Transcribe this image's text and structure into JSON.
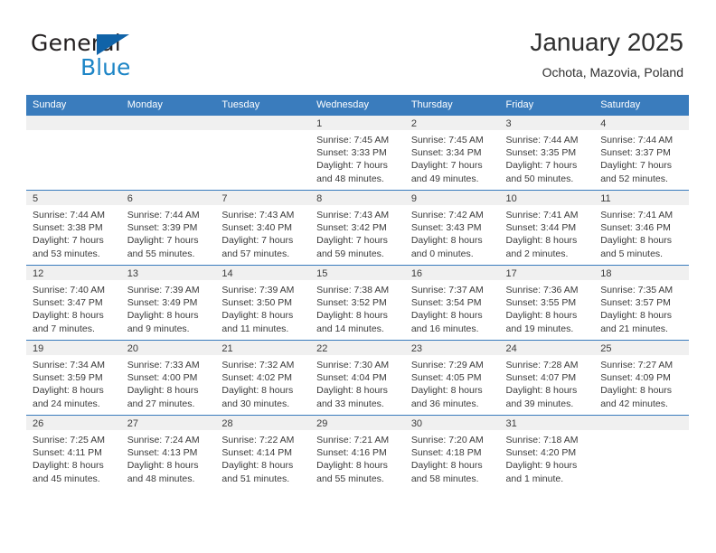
{
  "brand": {
    "name_part1": "General",
    "name_part2": "Blue",
    "triangle_color": "#1063a8",
    "blue_color": "#1d85c6"
  },
  "header": {
    "title": "January 2025",
    "location": "Ochota, Mazovia, Poland"
  },
  "theme": {
    "header_blue": "#3a7cbd",
    "band_gray": "#f0f0f0",
    "text": "#3a3a3a"
  },
  "weekdays": [
    "Sunday",
    "Monday",
    "Tuesday",
    "Wednesday",
    "Thursday",
    "Friday",
    "Saturday"
  ],
  "labels": {
    "sunrise_prefix": "Sunrise: ",
    "sunset_prefix": "Sunset: ",
    "daylight_prefix": "Daylight: "
  },
  "weeks": [
    [
      {
        "day": "",
        "empty": true
      },
      {
        "day": "",
        "empty": true
      },
      {
        "day": "",
        "empty": true
      },
      {
        "day": "1",
        "sunrise": "Sunrise: 7:45 AM",
        "sunset": "Sunset: 3:33 PM",
        "daylight1": "Daylight: 7 hours",
        "daylight2": "and 48 minutes."
      },
      {
        "day": "2",
        "sunrise": "Sunrise: 7:45 AM",
        "sunset": "Sunset: 3:34 PM",
        "daylight1": "Daylight: 7 hours",
        "daylight2": "and 49 minutes."
      },
      {
        "day": "3",
        "sunrise": "Sunrise: 7:44 AM",
        "sunset": "Sunset: 3:35 PM",
        "daylight1": "Daylight: 7 hours",
        "daylight2": "and 50 minutes."
      },
      {
        "day": "4",
        "sunrise": "Sunrise: 7:44 AM",
        "sunset": "Sunset: 3:37 PM",
        "daylight1": "Daylight: 7 hours",
        "daylight2": "and 52 minutes."
      }
    ],
    [
      {
        "day": "5",
        "sunrise": "Sunrise: 7:44 AM",
        "sunset": "Sunset: 3:38 PM",
        "daylight1": "Daylight: 7 hours",
        "daylight2": "and 53 minutes."
      },
      {
        "day": "6",
        "sunrise": "Sunrise: 7:44 AM",
        "sunset": "Sunset: 3:39 PM",
        "daylight1": "Daylight: 7 hours",
        "daylight2": "and 55 minutes."
      },
      {
        "day": "7",
        "sunrise": "Sunrise: 7:43 AM",
        "sunset": "Sunset: 3:40 PM",
        "daylight1": "Daylight: 7 hours",
        "daylight2": "and 57 minutes."
      },
      {
        "day": "8",
        "sunrise": "Sunrise: 7:43 AM",
        "sunset": "Sunset: 3:42 PM",
        "daylight1": "Daylight: 7 hours",
        "daylight2": "and 59 minutes."
      },
      {
        "day": "9",
        "sunrise": "Sunrise: 7:42 AM",
        "sunset": "Sunset: 3:43 PM",
        "daylight1": "Daylight: 8 hours",
        "daylight2": "and 0 minutes."
      },
      {
        "day": "10",
        "sunrise": "Sunrise: 7:41 AM",
        "sunset": "Sunset: 3:44 PM",
        "daylight1": "Daylight: 8 hours",
        "daylight2": "and 2 minutes."
      },
      {
        "day": "11",
        "sunrise": "Sunrise: 7:41 AM",
        "sunset": "Sunset: 3:46 PM",
        "daylight1": "Daylight: 8 hours",
        "daylight2": "and 5 minutes."
      }
    ],
    [
      {
        "day": "12",
        "sunrise": "Sunrise: 7:40 AM",
        "sunset": "Sunset: 3:47 PM",
        "daylight1": "Daylight: 8 hours",
        "daylight2": "and 7 minutes."
      },
      {
        "day": "13",
        "sunrise": "Sunrise: 7:39 AM",
        "sunset": "Sunset: 3:49 PM",
        "daylight1": "Daylight: 8 hours",
        "daylight2": "and 9 minutes."
      },
      {
        "day": "14",
        "sunrise": "Sunrise: 7:39 AM",
        "sunset": "Sunset: 3:50 PM",
        "daylight1": "Daylight: 8 hours",
        "daylight2": "and 11 minutes."
      },
      {
        "day": "15",
        "sunrise": "Sunrise: 7:38 AM",
        "sunset": "Sunset: 3:52 PM",
        "daylight1": "Daylight: 8 hours",
        "daylight2": "and 14 minutes."
      },
      {
        "day": "16",
        "sunrise": "Sunrise: 7:37 AM",
        "sunset": "Sunset: 3:54 PM",
        "daylight1": "Daylight: 8 hours",
        "daylight2": "and 16 minutes."
      },
      {
        "day": "17",
        "sunrise": "Sunrise: 7:36 AM",
        "sunset": "Sunset: 3:55 PM",
        "daylight1": "Daylight: 8 hours",
        "daylight2": "and 19 minutes."
      },
      {
        "day": "18",
        "sunrise": "Sunrise: 7:35 AM",
        "sunset": "Sunset: 3:57 PM",
        "daylight1": "Daylight: 8 hours",
        "daylight2": "and 21 minutes."
      }
    ],
    [
      {
        "day": "19",
        "sunrise": "Sunrise: 7:34 AM",
        "sunset": "Sunset: 3:59 PM",
        "daylight1": "Daylight: 8 hours",
        "daylight2": "and 24 minutes."
      },
      {
        "day": "20",
        "sunrise": "Sunrise: 7:33 AM",
        "sunset": "Sunset: 4:00 PM",
        "daylight1": "Daylight: 8 hours",
        "daylight2": "and 27 minutes."
      },
      {
        "day": "21",
        "sunrise": "Sunrise: 7:32 AM",
        "sunset": "Sunset: 4:02 PM",
        "daylight1": "Daylight: 8 hours",
        "daylight2": "and 30 minutes."
      },
      {
        "day": "22",
        "sunrise": "Sunrise: 7:30 AM",
        "sunset": "Sunset: 4:04 PM",
        "daylight1": "Daylight: 8 hours",
        "daylight2": "and 33 minutes."
      },
      {
        "day": "23",
        "sunrise": "Sunrise: 7:29 AM",
        "sunset": "Sunset: 4:05 PM",
        "daylight1": "Daylight: 8 hours",
        "daylight2": "and 36 minutes."
      },
      {
        "day": "24",
        "sunrise": "Sunrise: 7:28 AM",
        "sunset": "Sunset: 4:07 PM",
        "daylight1": "Daylight: 8 hours",
        "daylight2": "and 39 minutes."
      },
      {
        "day": "25",
        "sunrise": "Sunrise: 7:27 AM",
        "sunset": "Sunset: 4:09 PM",
        "daylight1": "Daylight: 8 hours",
        "daylight2": "and 42 minutes."
      }
    ],
    [
      {
        "day": "26",
        "sunrise": "Sunrise: 7:25 AM",
        "sunset": "Sunset: 4:11 PM",
        "daylight1": "Daylight: 8 hours",
        "daylight2": "and 45 minutes."
      },
      {
        "day": "27",
        "sunrise": "Sunrise: 7:24 AM",
        "sunset": "Sunset: 4:13 PM",
        "daylight1": "Daylight: 8 hours",
        "daylight2": "and 48 minutes."
      },
      {
        "day": "28",
        "sunrise": "Sunrise: 7:22 AM",
        "sunset": "Sunset: 4:14 PM",
        "daylight1": "Daylight: 8 hours",
        "daylight2": "and 51 minutes."
      },
      {
        "day": "29",
        "sunrise": "Sunrise: 7:21 AM",
        "sunset": "Sunset: 4:16 PM",
        "daylight1": "Daylight: 8 hours",
        "daylight2": "and 55 minutes."
      },
      {
        "day": "30",
        "sunrise": "Sunrise: 7:20 AM",
        "sunset": "Sunset: 4:18 PM",
        "daylight1": "Daylight: 8 hours",
        "daylight2": "and 58 minutes."
      },
      {
        "day": "31",
        "sunrise": "Sunrise: 7:18 AM",
        "sunset": "Sunset: 4:20 PM",
        "daylight1": "Daylight: 9 hours",
        "daylight2": "and 1 minute."
      },
      {
        "day": "",
        "empty": true
      }
    ]
  ]
}
